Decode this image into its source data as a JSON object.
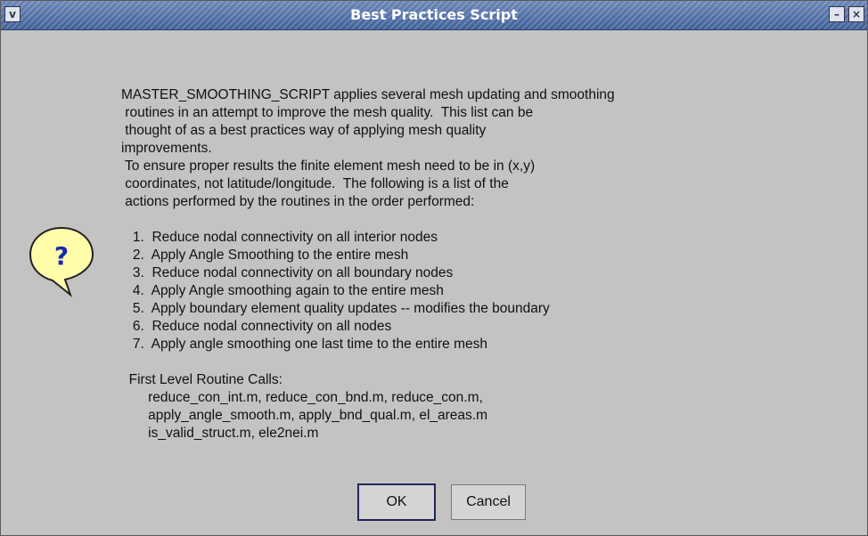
{
  "window": {
    "title": "Best Practices Script",
    "menu_glyph": "v",
    "minimize_glyph": "–",
    "close_glyph": "×"
  },
  "icon": {
    "name": "question-icon",
    "glyph": "?"
  },
  "message": {
    "lines": [
      "MASTER_SMOOTHING_SCRIPT applies several mesh updating and smoothing",
      " routines in an attempt to improve the mesh quality.  This list can be",
      " thought of as a best practices way of applying mesh quality",
      "improvements.",
      " To ensure proper results the finite element mesh need to be in (x,y)",
      " coordinates, not latitude/longitude.  The following is a list of the",
      " actions performed by the routines in the order performed:",
      "",
      "   1.  Reduce nodal connectivity on all interior nodes",
      "   2.  Apply Angle Smoothing to the entire mesh",
      "   3.  Reduce nodal connectivity on all boundary nodes",
      "   4.  Apply Angle smoothing again to the entire mesh",
      "   5.  Apply boundary element quality updates -- modifies the boundary",
      "   6.  Reduce nodal connectivity on all nodes",
      "   7.  Apply angle smoothing one last time to the entire mesh",
      "",
      "  First Level Routine Calls:",
      "       reduce_con_int.m, reduce_con_bnd.m, reduce_con.m,",
      "       apply_angle_smooth.m, apply_bnd_qual.m, el_areas.m",
      "       is_valid_struct.m, ele2nei.m"
    ]
  },
  "buttons": {
    "ok": "OK",
    "cancel": "Cancel"
  }
}
